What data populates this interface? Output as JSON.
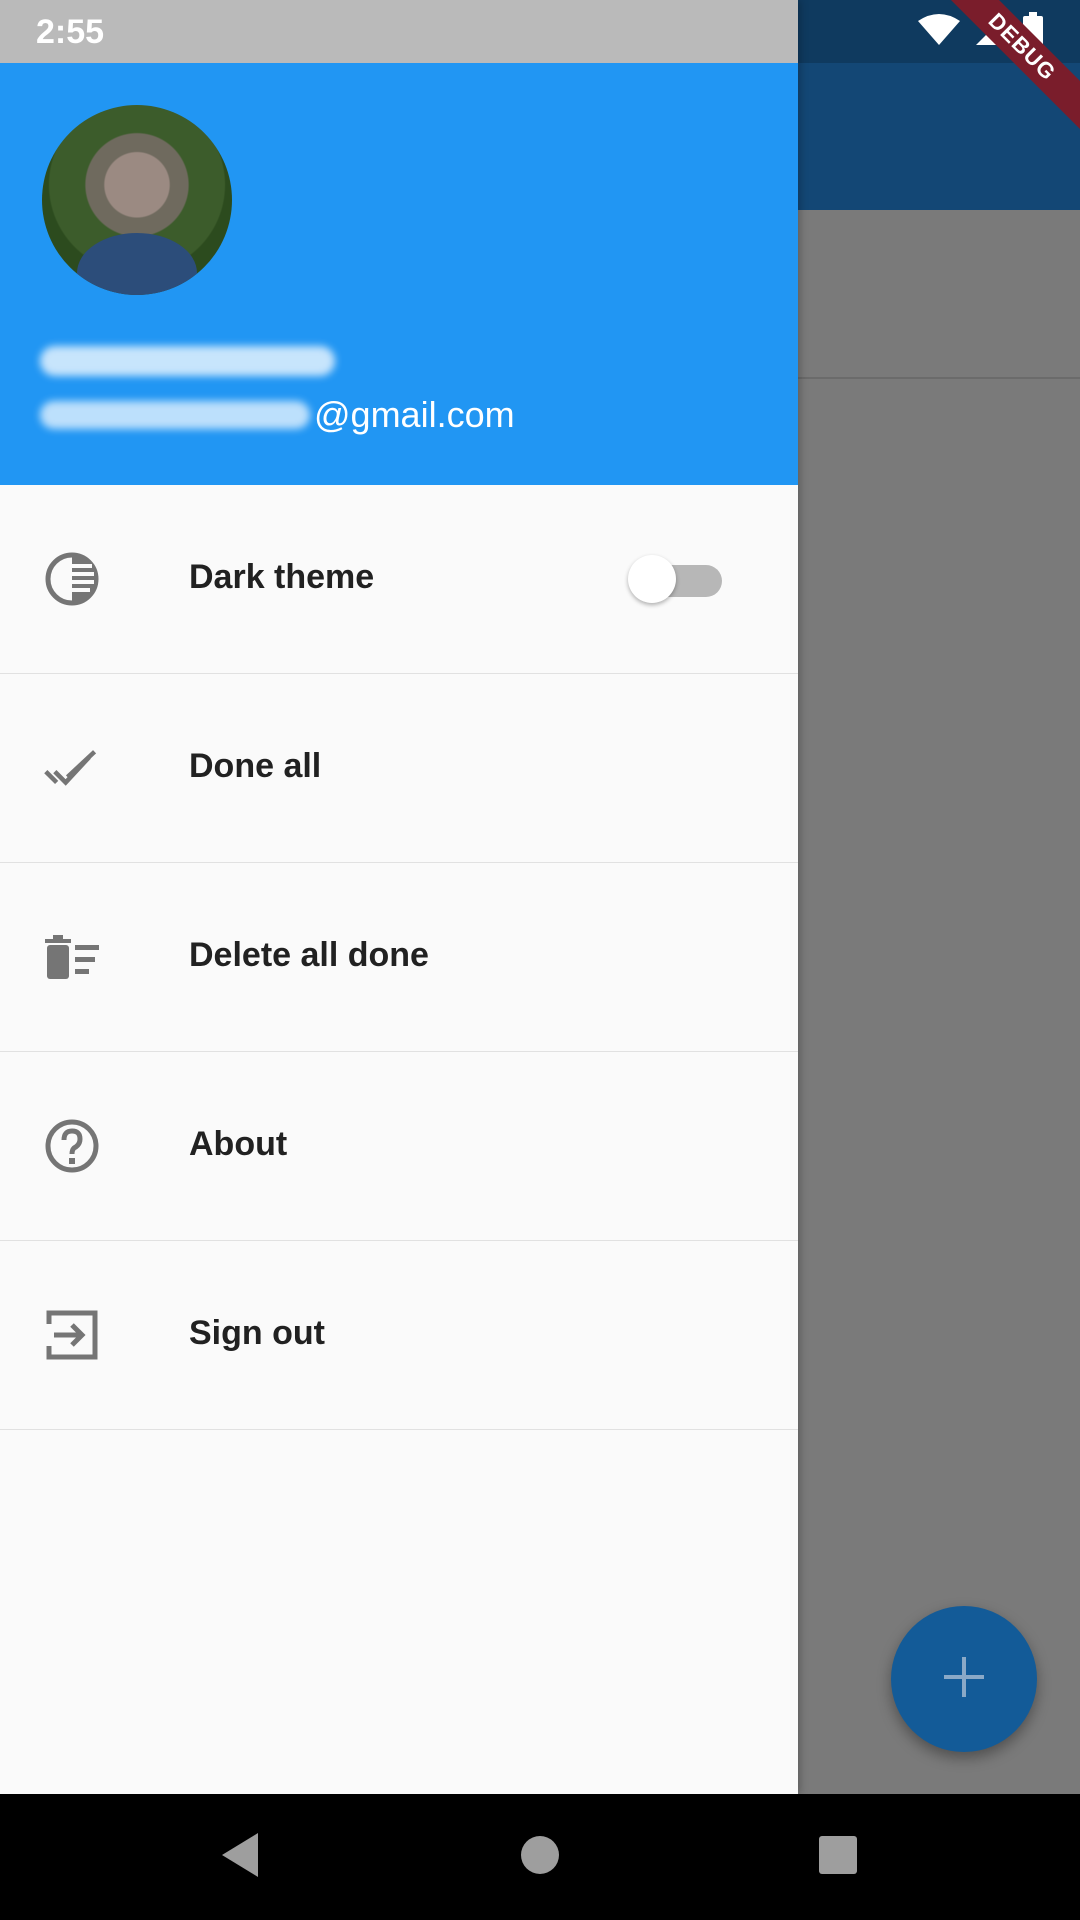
{
  "status_bar": {
    "time": "2:55",
    "icons": [
      "wifi-icon",
      "cell-signal-icon",
      "battery-icon"
    ]
  },
  "debug_banner": {
    "label": "DEBUG"
  },
  "drawer": {
    "header": {
      "email_suffix": "@gmail.com",
      "avatar": "profile-photo",
      "background_color": "#2196f3"
    },
    "items": [
      {
        "label": "Dark theme",
        "icon": "theme-toggle-icon",
        "has_toggle": true,
        "toggle_on": false
      },
      {
        "label": "Done all",
        "icon": "done-all-icon"
      },
      {
        "label": "Delete all done",
        "icon": "delete-sweep-icon"
      },
      {
        "label": "About",
        "icon": "help-outline-icon"
      },
      {
        "label": "Sign out",
        "icon": "exit-to-app-icon"
      }
    ]
  },
  "fab": {
    "icon": "plus-icon",
    "color": "#135b98"
  },
  "navigation_bar": {
    "buttons": [
      "back-icon",
      "home-icon",
      "recents-icon"
    ]
  }
}
